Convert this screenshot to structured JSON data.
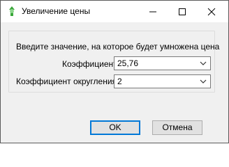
{
  "window": {
    "title": "Увеличение цены",
    "controls": [
      "minimize-icon",
      "maximize-icon",
      "close-icon"
    ]
  },
  "form": {
    "prompt": "Введите значение, на которое будет умножена цена",
    "coefficient": {
      "label": "Коэффициент:",
      "value": "25,76"
    },
    "rounding": {
      "label": "Коэффициент округления:",
      "value": "2"
    }
  },
  "buttons": {
    "ok": "OK",
    "cancel": "Отмена"
  },
  "colors": {
    "accent": "#0078d7",
    "icon_green": "#3aa63a"
  }
}
